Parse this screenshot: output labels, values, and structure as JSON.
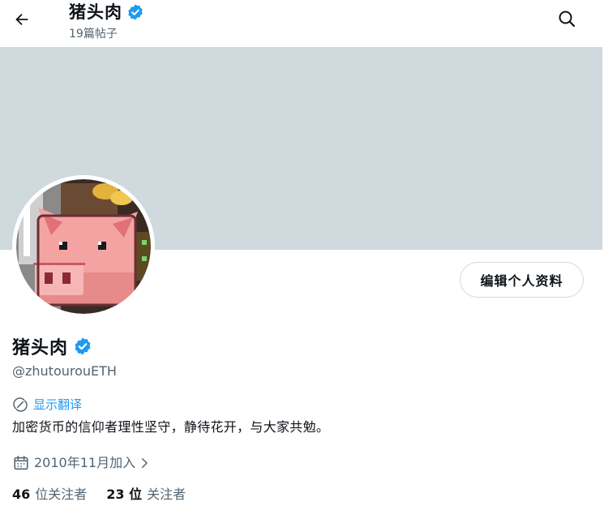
{
  "header": {
    "title": "猪头肉",
    "post_count": "19篇帖子"
  },
  "profile": {
    "display_name": "猪头肉",
    "handle": "@zhutourouETH",
    "translate_label": "显示翻译",
    "bio": "加密货币的信仰者理性坚守，静待花开，与大家共勉。",
    "joined": "2010年11月加入",
    "edit_button": "编辑个人资料",
    "following": {
      "count": "46",
      "label": "位关注者"
    },
    "followers": {
      "count": "23 位",
      "label": "关注者"
    }
  },
  "colors": {
    "accent": "#1d9bf0",
    "banner": "#cfd9de",
    "secondary_text": "#536471",
    "primary_text": "#0f1419"
  },
  "icons": {
    "back": "arrow-left-icon",
    "search": "search-icon",
    "verified": "verified-badge-icon",
    "translate": "translate-icon",
    "calendar": "calendar-icon",
    "chevron": "chevron-right-icon"
  }
}
